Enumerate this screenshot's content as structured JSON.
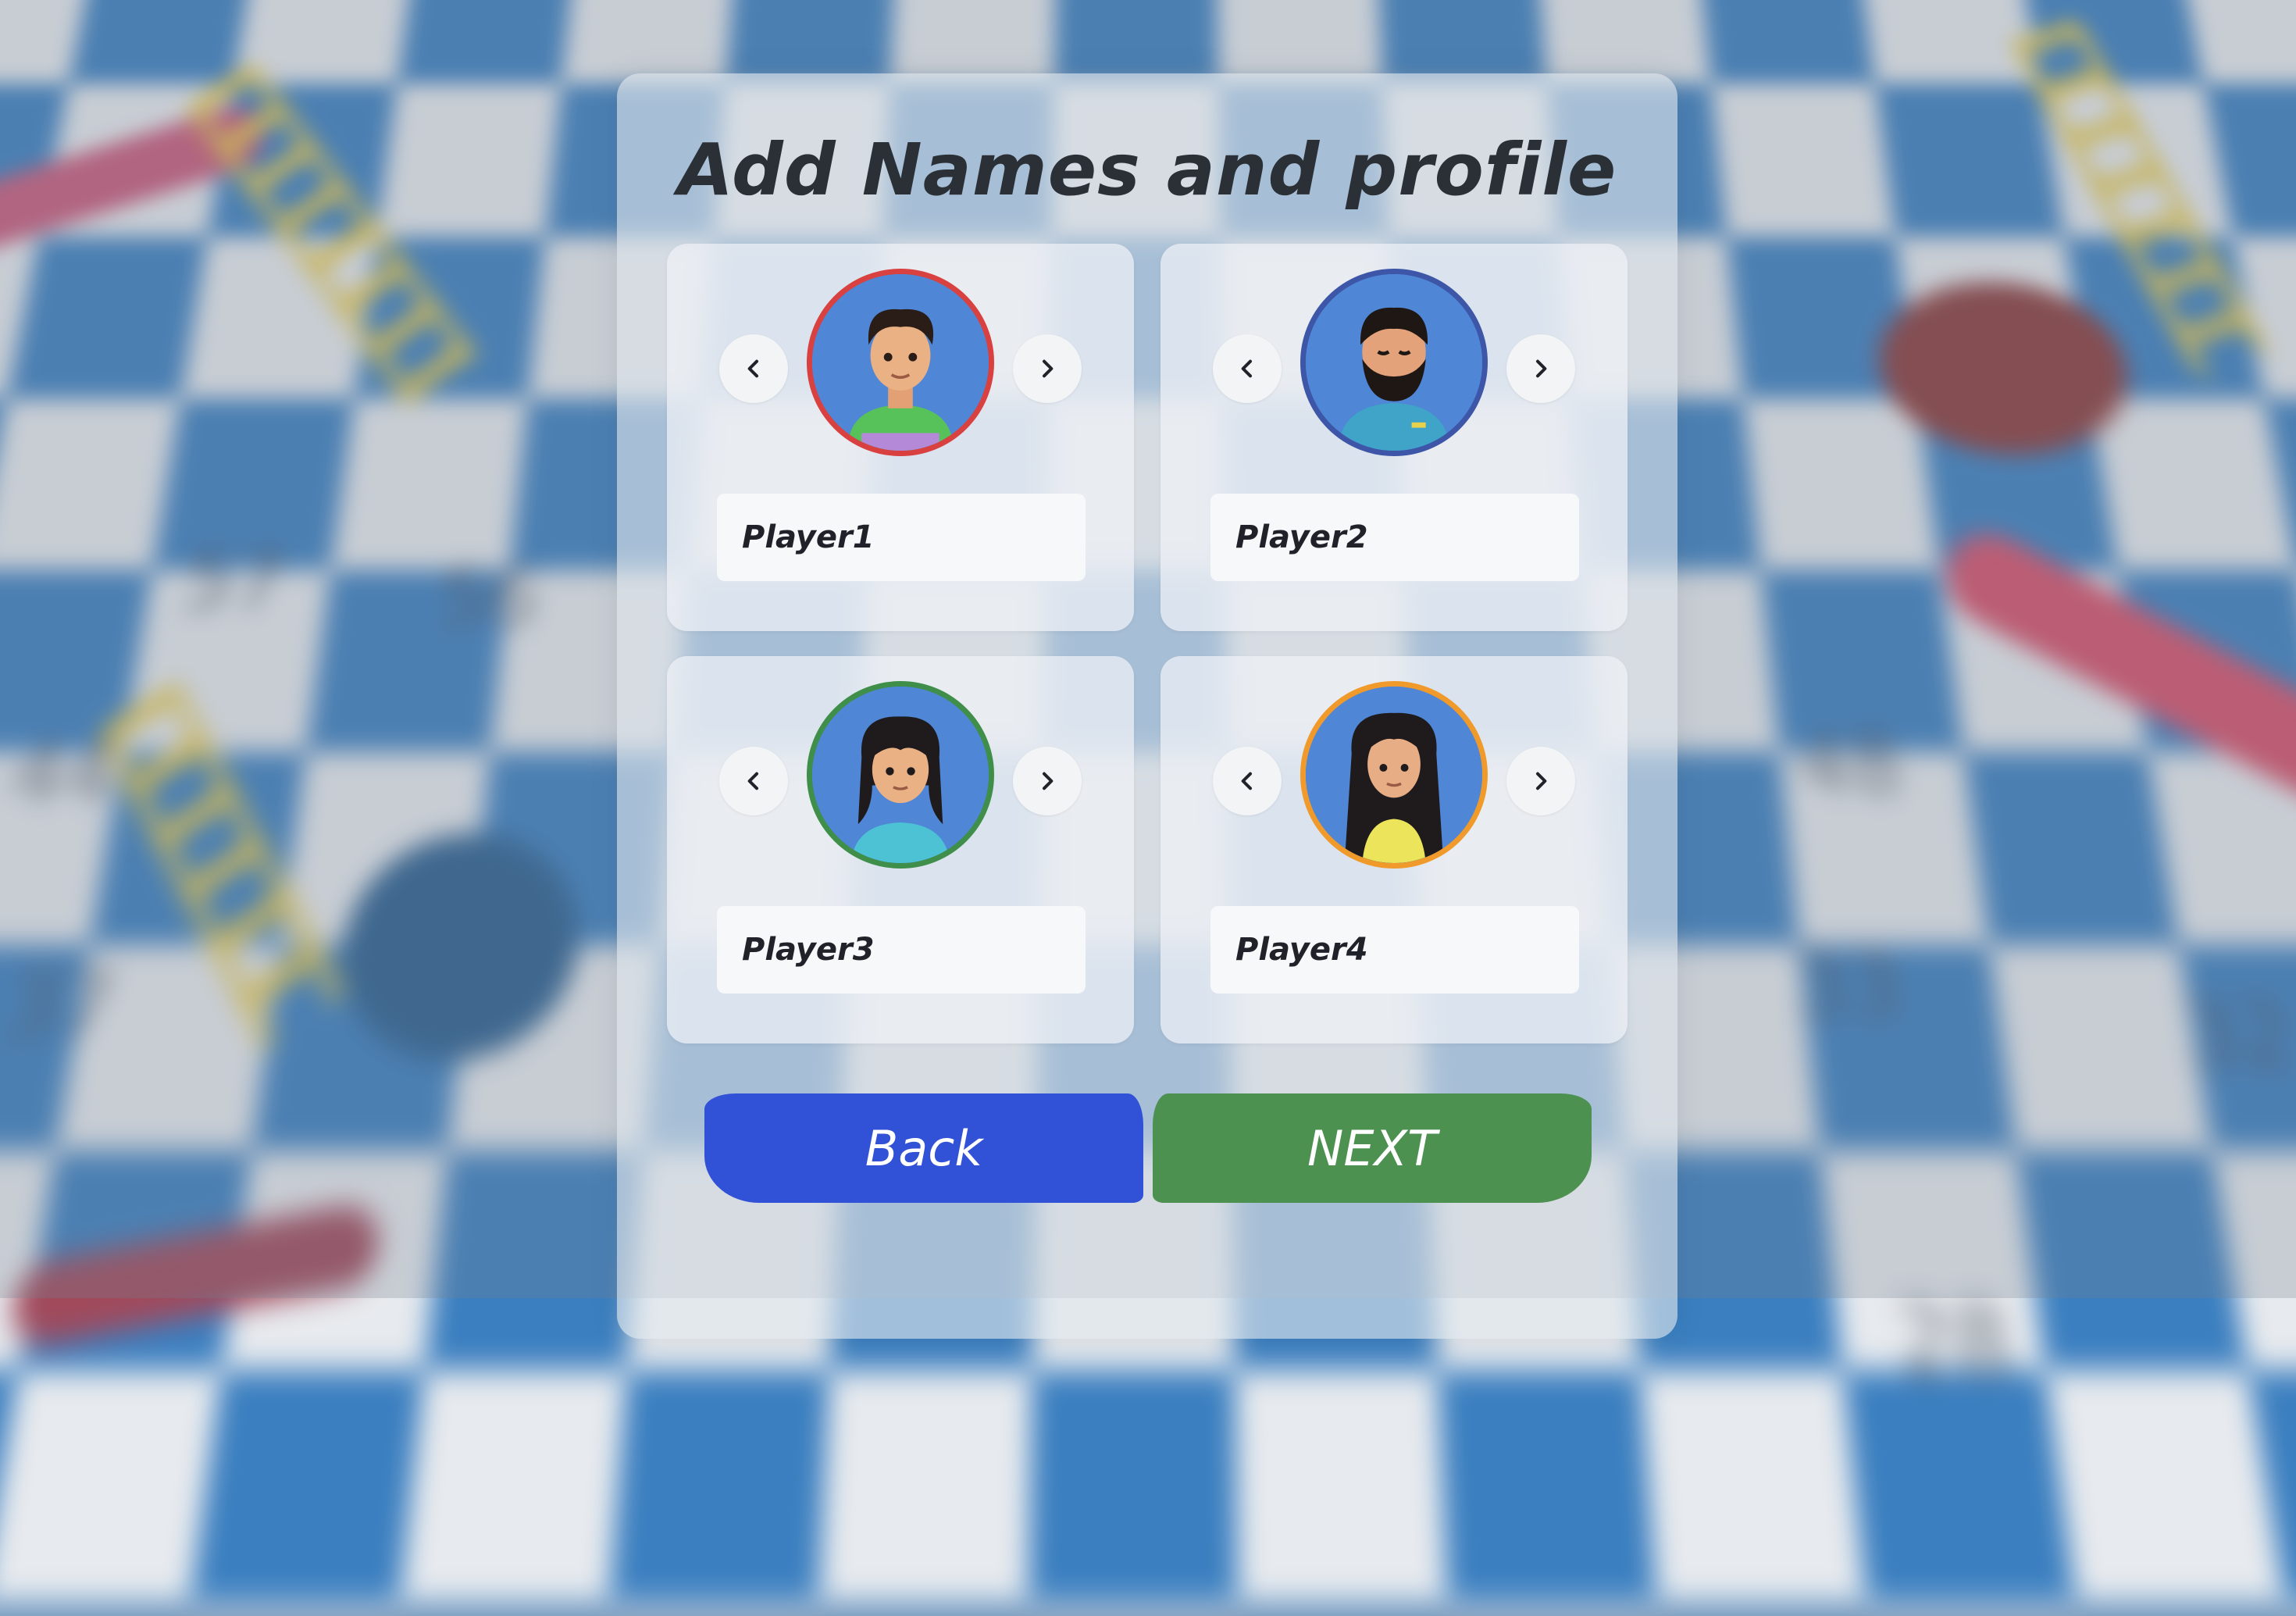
{
  "title": "Add Names and profile",
  "players": [
    {
      "name": "Player1",
      "ring_color": "#d94040",
      "avatar_icon": "boy-avatar-icon"
    },
    {
      "name": "Player2",
      "ring_color": "#3e56a8",
      "avatar_icon": "bearded-man-avatar-icon"
    },
    {
      "name": "Player3",
      "ring_color": "#3f8f4a",
      "avatar_icon": "girl-avatar-icon"
    },
    {
      "name": "Player4",
      "ring_color": "#ef9a2a",
      "avatar_icon": "long-hair-woman-avatar-icon"
    }
  ],
  "arrows": {
    "prev_icon": "chevron-left-icon",
    "next_icon": "chevron-right-icon"
  },
  "buttons": {
    "back": "Back",
    "next": "NEXT",
    "back_color": "#3152d6",
    "next_color": "#4d9150"
  },
  "background": {
    "board_numbers": [
      "44",
      "37",
      "24",
      "33",
      "32",
      "29",
      "28",
      "48",
      "57",
      "56"
    ]
  }
}
